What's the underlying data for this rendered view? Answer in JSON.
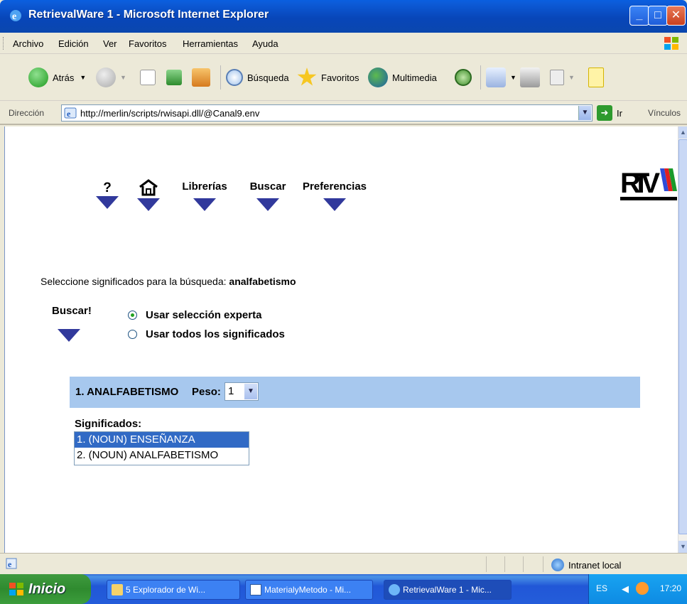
{
  "window": {
    "title": "RetrievalWare 1 - Microsoft Internet Explorer",
    "minimize_icon": "minimize-icon",
    "maximize_icon": "maximize-icon",
    "close_icon": "close-icon"
  },
  "menu": {
    "items": [
      "Archivo",
      "Edición",
      "Ver",
      "Favoritos",
      "Herramientas",
      "Ayuda"
    ]
  },
  "toolbar": {
    "back": "Atrás",
    "search": "Búsqueda",
    "favorites": "Favoritos",
    "media": "Multimedia"
  },
  "address": {
    "label": "Dirección",
    "url": "http://merlin/scripts/rwisapi.dll/@Canal9.env",
    "go": "Ir",
    "links": "Vínculos"
  },
  "page": {
    "nav": {
      "help": "?",
      "libraries": "Librerías",
      "search": "Buscar",
      "preferences": "Preferencias"
    },
    "prompt_prefix": "Seleccione significados para la búsqueda:",
    "query": "analfabetismo",
    "buscar": "Buscar!",
    "radio_expert": "Usar selección experta",
    "radio_all": "Usar todos los significados",
    "selected_radio": "expert",
    "term_heading": "1. ANALFABETISMO",
    "peso_label": "Peso:",
    "peso_value": "1",
    "meanings_label": "Significados:",
    "meanings": [
      {
        "text": "1. (NOUN) ENSEÑANZA",
        "selected": true
      },
      {
        "text": "2. (NOUN) ANALFABETISMO",
        "selected": false
      }
    ],
    "colors": {
      "nav_triangle": "#31399C",
      "term_bar": "#A7C8EE",
      "selection": "#316AC5"
    }
  },
  "status": {
    "zone": "Intranet local"
  },
  "taskbar": {
    "start": "Inicio",
    "tasks": [
      "5 Explorador de Wi...",
      "MaterialyMetodo - Mi...",
      "RetrievalWare 1 - Mic..."
    ],
    "lang": "ES",
    "time": "17:20"
  }
}
